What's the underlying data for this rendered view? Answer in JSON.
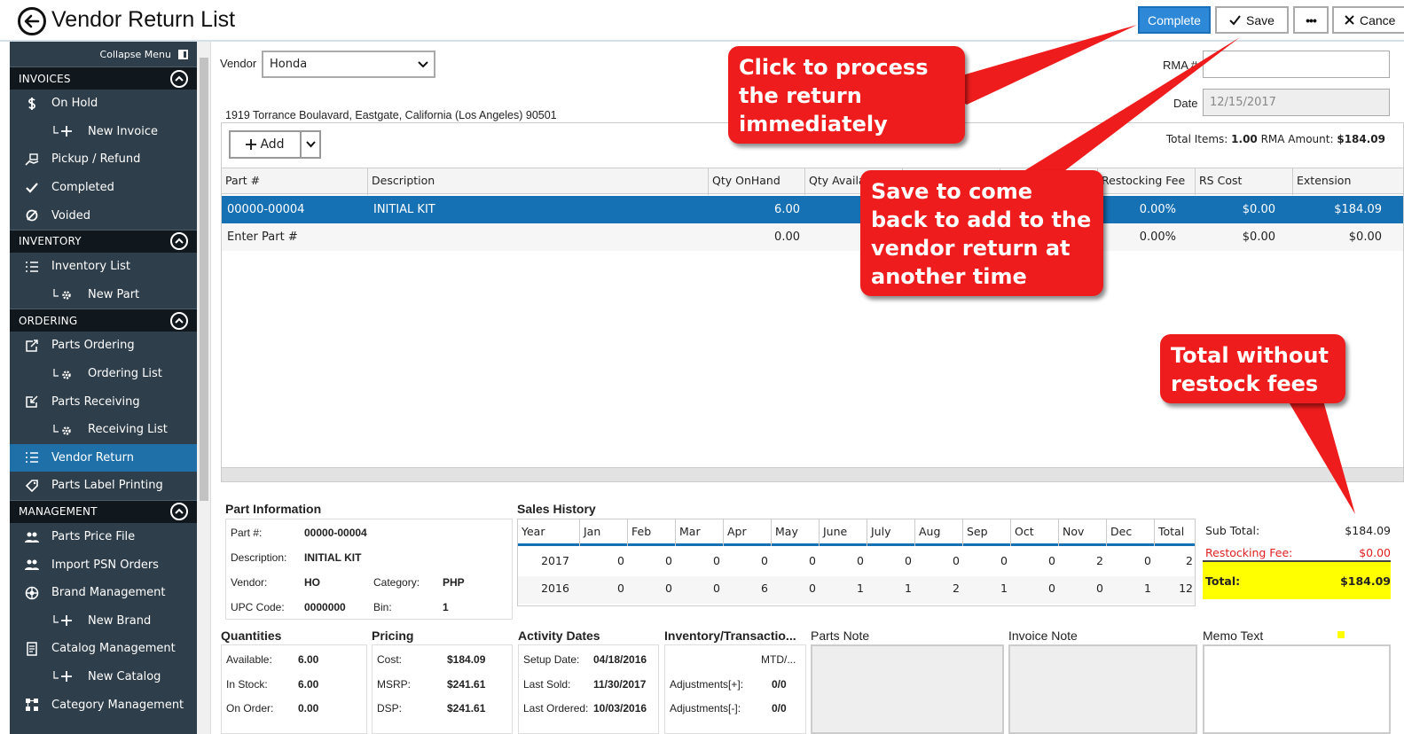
{
  "header": {
    "title": "Vendor Return List",
    "complete_label": "Complete",
    "save_label": "Save",
    "more_label": "•••",
    "cancel_label": "Cance"
  },
  "sidebar": {
    "collapse_label": "Collapse Menu",
    "sections": [
      {
        "title": "INVOICES",
        "items": [
          {
            "label": "On Hold",
            "icon": "dollar-icon",
            "sub": false
          },
          {
            "label": "New Invoice",
            "icon": "plus-icon",
            "sub": true
          },
          {
            "label": "Pickup / Refund",
            "icon": "hand-cash-icon",
            "sub": false
          },
          {
            "label": "Completed",
            "icon": "check-icon",
            "sub": false
          },
          {
            "label": "Voided",
            "icon": "void-icon",
            "sub": false
          }
        ]
      },
      {
        "title": "INVENTORY",
        "items": [
          {
            "label": "Inventory List",
            "icon": "list-icon",
            "sub": false
          },
          {
            "label": "New Part",
            "icon": "gear-icon",
            "sub": true
          }
        ]
      },
      {
        "title": "ORDERING",
        "items": [
          {
            "label": "Parts Ordering",
            "icon": "export-icon",
            "sub": false
          },
          {
            "label": "Ordering List",
            "icon": "gear-icon",
            "sub": true
          },
          {
            "label": "Parts Receiving",
            "icon": "import-icon",
            "sub": false
          },
          {
            "label": "Receiving List",
            "icon": "gear-icon",
            "sub": true
          },
          {
            "label": "Vendor Return",
            "icon": "list-icon",
            "sub": false,
            "active": true
          },
          {
            "label": "Parts Label Printing",
            "icon": "label-icon",
            "sub": false
          }
        ]
      },
      {
        "title": "MANAGEMENT",
        "items": [
          {
            "label": "Parts Price File",
            "icon": "users-icon",
            "sub": false
          },
          {
            "label": "Import PSN Orders",
            "icon": "users-icon",
            "sub": false
          },
          {
            "label": "Brand Management",
            "icon": "brand-icon",
            "sub": false
          },
          {
            "label": "New Brand",
            "icon": "plus-icon",
            "sub": true
          },
          {
            "label": "Catalog Management",
            "icon": "catalog-icon",
            "sub": false
          },
          {
            "label": "New Catalog",
            "icon": "plus-icon",
            "sub": true
          },
          {
            "label": "Category Management",
            "icon": "category-icon",
            "sub": false
          }
        ]
      }
    ]
  },
  "form": {
    "vendor_label": "Vendor",
    "vendor_value": "Honda",
    "address": "1919 Torrance Boulavard, Eastgate, California (Los Angeles) 90501",
    "rma_label": "RMA #",
    "rma_value": "",
    "date_label": "Date",
    "date_value": "12/15/2017"
  },
  "grid": {
    "add_label": "Add",
    "total_items_label": "Total Items:",
    "total_items_value": "1.00",
    "rma_amount_label": "RMA Amount:",
    "rma_amount_value": "$184.09",
    "columns": [
      "Part #",
      "Description",
      "Qty OnHand",
      "Qty Availa",
      "",
      "",
      "Restocking Fee",
      "RS Cost",
      "Extension"
    ],
    "rows": [
      {
        "part": "00000-00004",
        "desc": "INITIAL KIT",
        "qty": "6.00",
        "fee": "0.00%",
        "rs": "$0.00",
        "ext": "$184.09"
      },
      {
        "part": "Enter Part #",
        "desc": "",
        "qty": "0.00",
        "fee": "0.00%",
        "rs": "$0.00",
        "ext": "$0.00"
      }
    ]
  },
  "part_info": {
    "title": "Part Information",
    "part_label": "Part #:",
    "part_value": "00000-00004",
    "desc_label": "Description:",
    "desc_value": "INITIAL KIT",
    "vendor_label": "Vendor:",
    "vendor_value": "HO",
    "category_label": "Category:",
    "category_value": "PHP",
    "upc_label": "UPC Code:",
    "upc_value": "0000000",
    "bin_label": "Bin:",
    "bin_value": "1"
  },
  "sales_history": {
    "title": "Sales History",
    "columns": [
      "Year",
      "Jan",
      "Feb",
      "Mar",
      "Apr",
      "May",
      "June",
      "July",
      "Aug",
      "Sep",
      "Oct",
      "Nov",
      "Dec",
      "Total"
    ],
    "rows": [
      [
        "2017",
        "0",
        "0",
        "0",
        "0",
        "0",
        "0",
        "0",
        "0",
        "0",
        "0",
        "2",
        "0",
        "2"
      ],
      [
        "2016",
        "0",
        "0",
        "0",
        "6",
        "0",
        "1",
        "1",
        "2",
        "1",
        "0",
        "0",
        "1",
        "12"
      ]
    ]
  },
  "summary": {
    "sub_total_label": "Sub Total:",
    "sub_total_value": "$184.09",
    "restock_label": "Restocking Fee:",
    "restock_value": "$0.00",
    "total_label": "Total:",
    "total_value": "$184.09",
    "highlight_color": "#ffff00",
    "restock_color": "#e02020"
  },
  "quantities": {
    "title": "Quantities",
    "available_label": "Available:",
    "available_value": "6.00",
    "instock_label": "In Stock:",
    "instock_value": "6.00",
    "onorder_label": "On Order:",
    "onorder_value": "0.00"
  },
  "pricing": {
    "title": "Pricing",
    "cost_label": "Cost:",
    "cost_value": "$184.09",
    "msrp_label": "MSRP:",
    "msrp_value": "$241.61",
    "dsp_label": "DSP:",
    "dsp_value": "$241.61"
  },
  "activity": {
    "title": "Activity Dates",
    "setup_label": "Setup Date:",
    "setup_value": "04/18/2016",
    "sold_label": "Last Sold:",
    "sold_value": "11/30/2017",
    "ordered_label": "Last Ordered:",
    "ordered_value": "10/03/2016"
  },
  "inventory_tx": {
    "title": "Inventory/Transactio...",
    "mtd_label": "MTD/...",
    "adj_plus_label": "Adjustments[+]:",
    "adj_plus_value": "0/0",
    "adj_minus_label": "Adjustments[-]:",
    "adj_minus_value": "0/0"
  },
  "notes": {
    "parts_note": "Parts Note",
    "invoice_note": "Invoice Note",
    "memo_text": "Memo Text"
  },
  "callouts": {
    "complete": [
      "Click to process",
      "the return",
      "immediately"
    ],
    "save": [
      "Save to come",
      "back to add to the",
      "vendor return at",
      "another time"
    ],
    "total": [
      "Total without",
      "restock fees"
    ],
    "color": "#ee1c1c"
  }
}
